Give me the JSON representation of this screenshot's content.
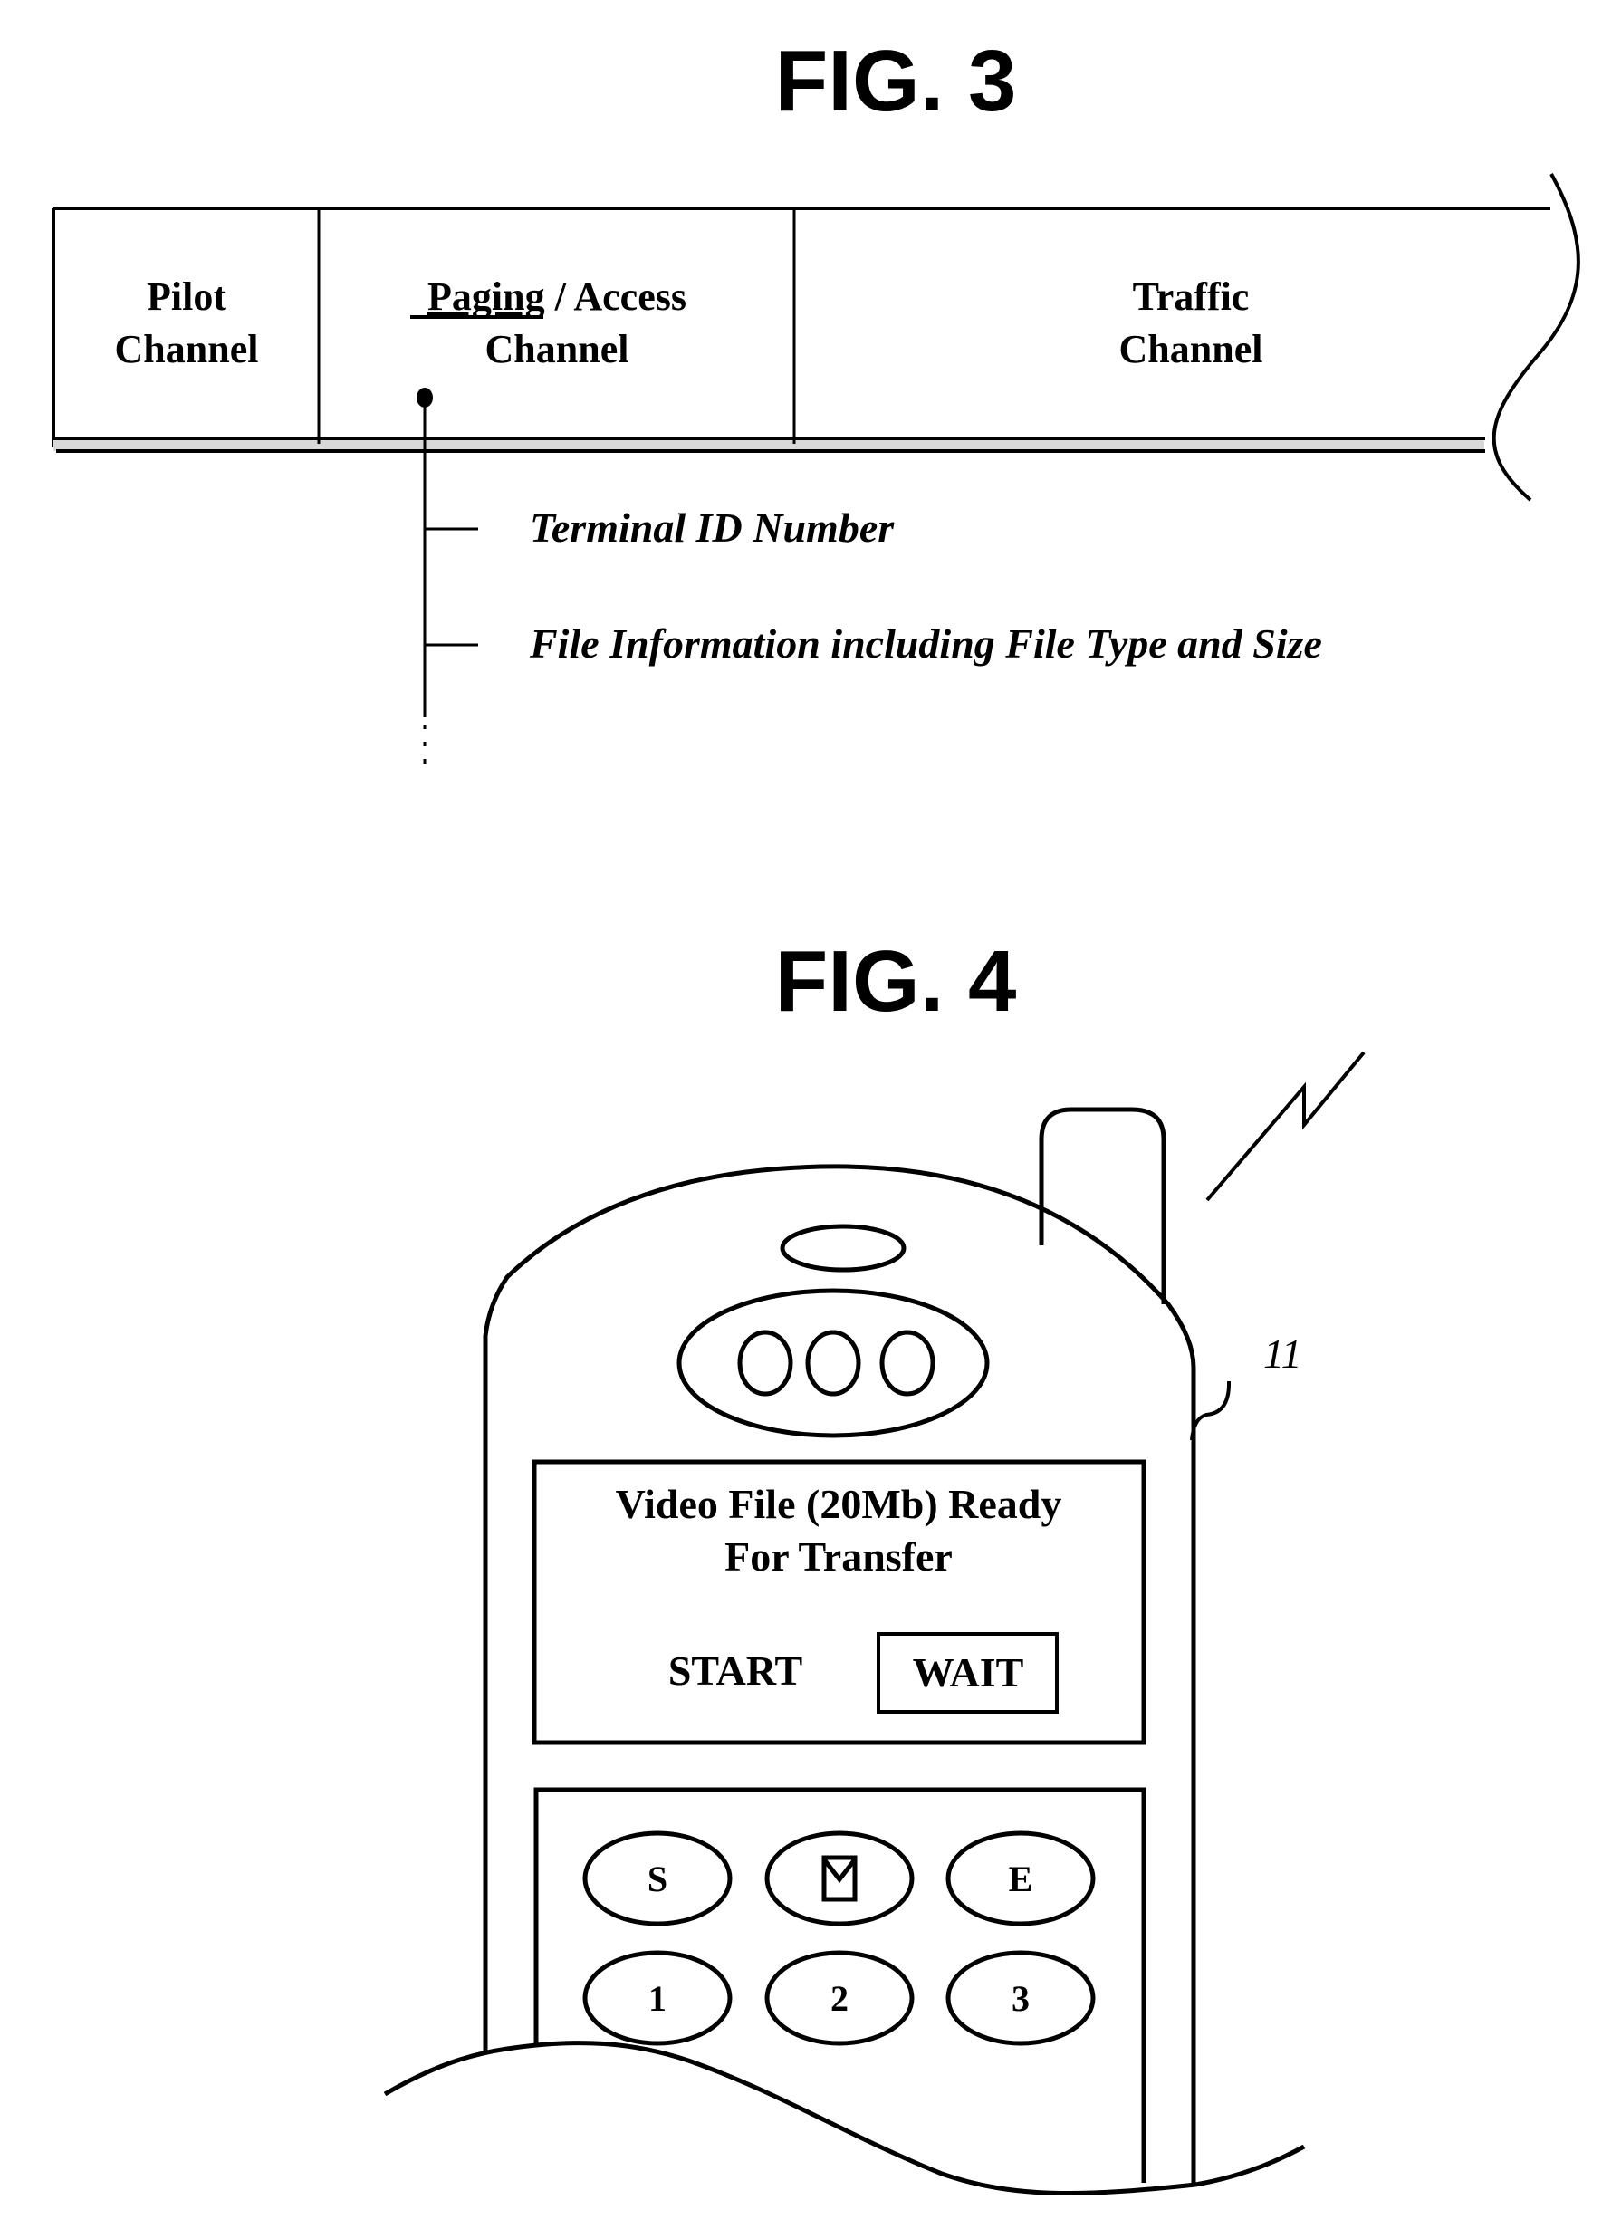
{
  "colors": {
    "ink": "#000000",
    "paper": "#ffffff"
  },
  "fig3": {
    "title": "FIG. 3",
    "channels": [
      {
        "line1": "Pilot",
        "line2": "Channel"
      },
      {
        "line1_underlined": "Paging",
        "line1_rest": " / Access",
        "line2": "Channel"
      },
      {
        "line1": "Traffic",
        "line2": "Channel"
      }
    ],
    "fields": [
      "Terminal ID Number",
      "File Information including File Type and Size"
    ],
    "more_fields_indicator": "ellipsis-vertical"
  },
  "fig4": {
    "title": "FIG. 4",
    "reference_numeral": "11",
    "screen": {
      "message_line1": "Video File (20Mb) Ready",
      "message_line2": "For Transfer",
      "option_start": "START",
      "option_wait": "WAIT",
      "selected_option": "WAIT"
    },
    "keypad": {
      "row1": [
        "S",
        "mail-icon",
        "E"
      ],
      "row2": [
        "1",
        "2",
        "3"
      ],
      "labels": {
        "s": "S",
        "e": "E",
        "k1": "1",
        "k2": "2",
        "k3": "3"
      }
    },
    "icons": [
      "antenna",
      "signal-lightning-icon",
      "earpiece",
      "mail-icon"
    ]
  }
}
